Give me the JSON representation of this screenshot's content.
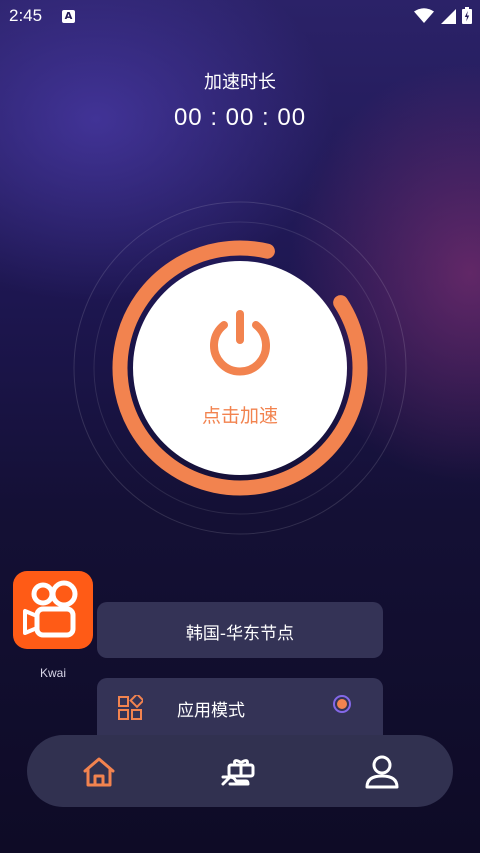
{
  "status_bar": {
    "time": "2:45",
    "notification_icon": "a-icon",
    "right_icons": [
      "wifi-icon",
      "signal-icon",
      "battery-icon"
    ]
  },
  "timer": {
    "label": "加速时长",
    "value": "00 : 00 : 00"
  },
  "power": {
    "label": "点击加速",
    "icon": "power-icon"
  },
  "app": {
    "name": "Kwai",
    "icon": "kwai-icon"
  },
  "node": {
    "label": "韩国-华东节点"
  },
  "mode": {
    "label": "应用模式",
    "icon": "apps-grid-icon",
    "selected": true
  },
  "nav": {
    "items": [
      {
        "icon": "home-icon",
        "active": true
      },
      {
        "icon": "gift-icon",
        "active": false
      },
      {
        "icon": "user-icon",
        "active": false
      }
    ]
  },
  "colors": {
    "accent": "#f2834f",
    "card": "#343356",
    "radio_ring": "#8468e8",
    "kwai": "#ff5b16"
  }
}
